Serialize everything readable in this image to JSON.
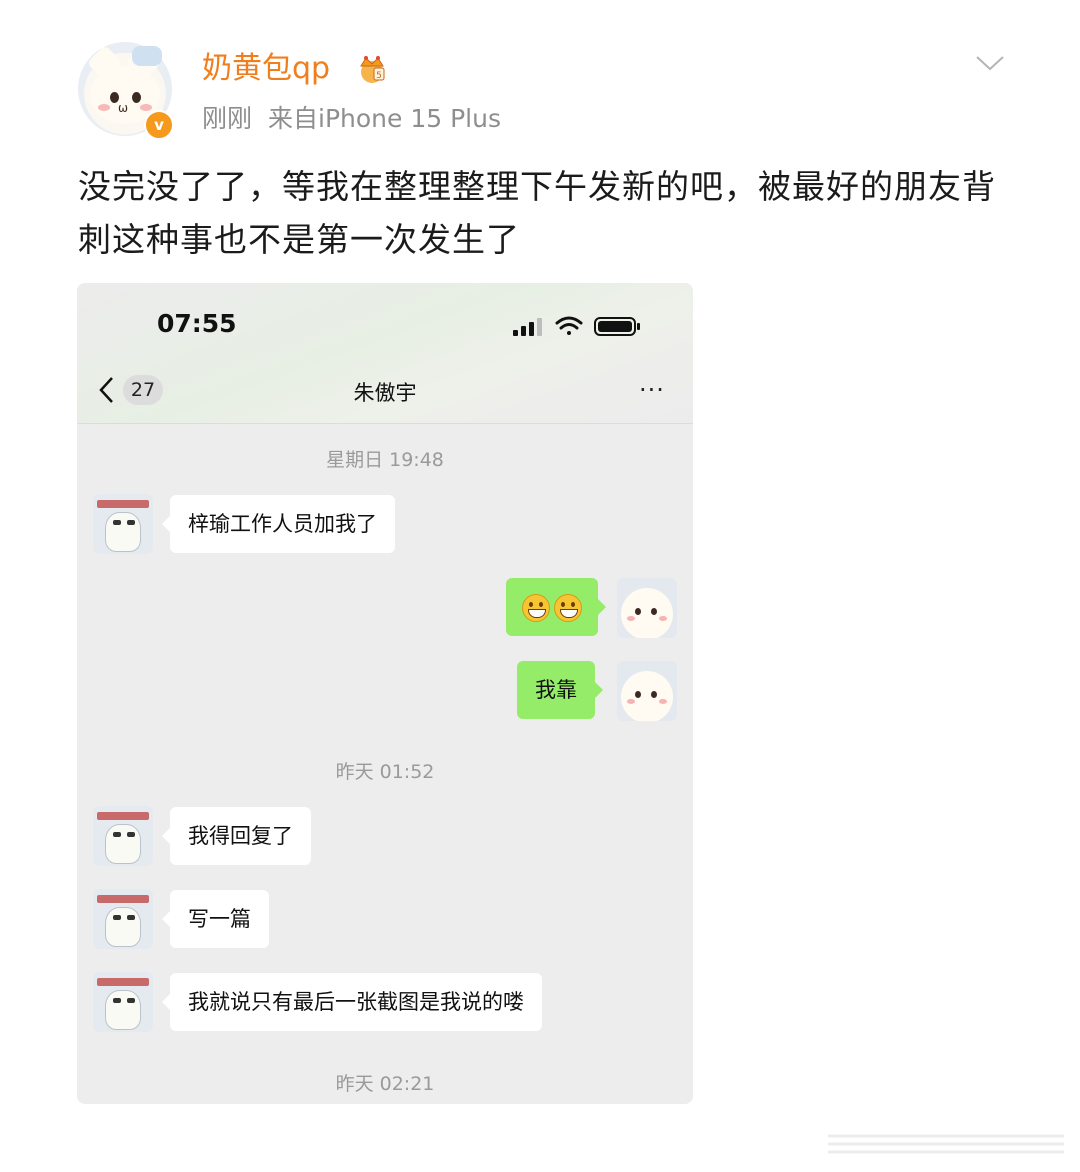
{
  "post": {
    "username": "奶黄包qp",
    "verified_badge": "v",
    "time": "刚刚",
    "source": "来自iPhone 15 Plus",
    "text": "没完没了了，等我在整理整理下午发新的吧，被最好的朋友背刺这种事也不是第一次发生了",
    "username_color": "#f07e1d"
  },
  "screenshot": {
    "status_time": "07:55",
    "unread_count": "27",
    "contact_name": "朱傲宇",
    "more_label": "···",
    "timestamps": [
      "星期日 19:48",
      "昨天 01:52",
      "昨天 02:21"
    ],
    "messages": [
      {
        "side": "left",
        "text": "梓瑜工作人员加我了"
      },
      {
        "side": "right",
        "text": "",
        "emoji": "grinning-face-icon"
      },
      {
        "side": "right",
        "text": "我靠"
      },
      {
        "side": "left",
        "text": "我得回复了"
      },
      {
        "side": "left",
        "text": "写一篇"
      },
      {
        "side": "left",
        "text": "我就说只有最后一张截图是我说的喽"
      }
    ],
    "bubble_colors": {
      "self": "#95ec69",
      "other": "#ffffff"
    }
  }
}
